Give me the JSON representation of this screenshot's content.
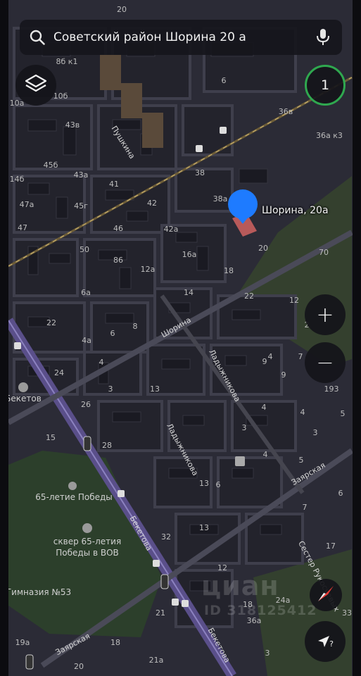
{
  "search": {
    "query": "Советский район Шорина 20 а"
  },
  "counter": {
    "value": "1"
  },
  "zoom": {
    "in_label": "+",
    "out_label": "−"
  },
  "locate": {
    "badge": "?"
  },
  "pin": {
    "label": "Шорина, 20а"
  },
  "watermark": {
    "brand": "циан",
    "id": "ID 318125412"
  },
  "colors": {
    "pin": "#1e7bff",
    "counter_ring": "#2fa84f",
    "park": "#2c3f2b",
    "rail": "#5a4f8a"
  },
  "streets": [
    "Пушкина",
    "Шорина",
    "Ладыжникова",
    "Ладыжникова",
    "Заярская",
    "Заярская",
    "Бекетова",
    "Бекетова",
    "Сестер Рукосуевых"
  ],
  "pois": [
    "Бекетов",
    "65-летие Победы",
    "сквер 65-летия",
    "Победы в ВОВ",
    "Гимназия №53"
  ],
  "house_numbers": [
    "20",
    "8б к1",
    "10б",
    "10а",
    "43в",
    "45б",
    "14б",
    "47а",
    "47",
    "41",
    "43а",
    "45г",
    "42",
    "46",
    "42а",
    "50",
    "86",
    "6а",
    "12а",
    "16а",
    "14",
    "18",
    "22",
    "22",
    "8",
    "6",
    "4а",
    "4",
    "24",
    "3",
    "26",
    "15",
    "28",
    "13",
    "32",
    "13",
    "12",
    "21",
    "21а",
    "18",
    "19а",
    "20",
    "38",
    "38а",
    "20",
    "70",
    "12",
    "2",
    "9",
    "7",
    "193",
    "9",
    "4",
    "4",
    "3",
    "4",
    "5",
    "5",
    "6",
    "3",
    "6",
    "7",
    "17",
    "18",
    "24а",
    "36а",
    "3",
    "33",
    "36в",
    "36а к3",
    "6",
    "4",
    "13"
  ]
}
